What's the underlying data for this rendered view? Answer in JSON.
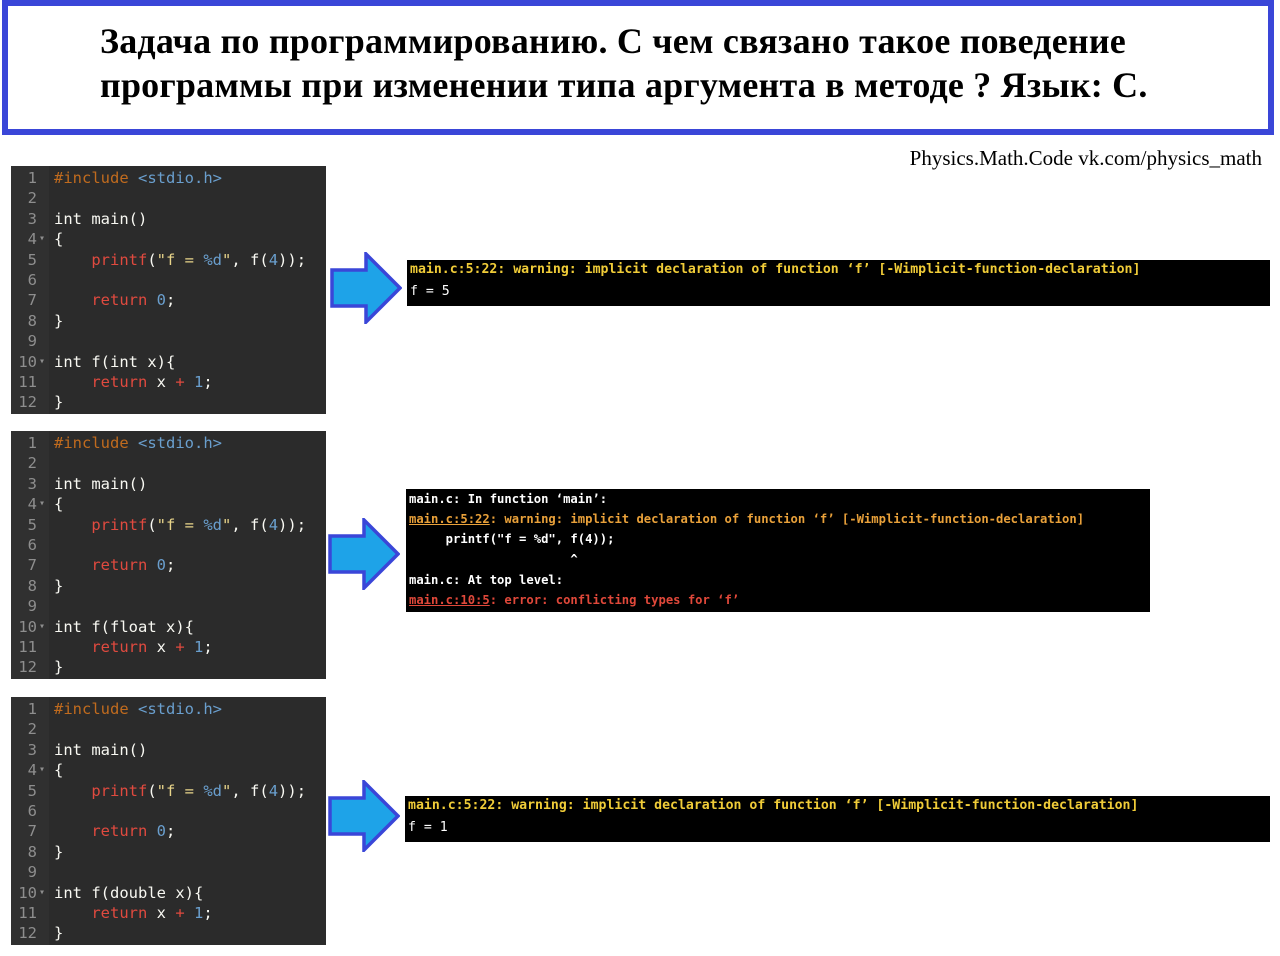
{
  "title": {
    "line1": "Задача по программированию. С чем связано такое поведение",
    "line2": "программы при изменении типа аргумента в методе ? Язык: C."
  },
  "credit": "Physics.Math.Code vk.com/physics_math",
  "colors": {
    "frame": "#3a46d8",
    "arrow": "#1ea3e8",
    "arrow_border": "#3a46d8",
    "warning": "#f0cc38",
    "error": "#e0483a"
  },
  "arrow_icon": "right-arrow-icon",
  "panels": [
    {
      "code": {
        "lines": [
          {
            "n": "1",
            "fold": ""
          },
          {
            "n": "2",
            "fold": ""
          },
          {
            "n": "3",
            "fold": ""
          },
          {
            "n": "4",
            "fold": "▾"
          },
          {
            "n": "5",
            "fold": ""
          },
          {
            "n": "6",
            "fold": ""
          },
          {
            "n": "7",
            "fold": ""
          },
          {
            "n": "8",
            "fold": ""
          },
          {
            "n": "9",
            "fold": ""
          },
          {
            "n": "10",
            "fold": "▾"
          },
          {
            "n": "11",
            "fold": ""
          },
          {
            "n": "12",
            "fold": ""
          }
        ],
        "include": "#include",
        "header": "<stdio.h>",
        "main_sig": "int main()",
        "open_brace": "{",
        "printf": "printf",
        "printf_open": "(",
        "str_a": "\"f = ",
        "str_fmt": "%d",
        "str_b": "\"",
        "printf_mid": ", f(",
        "arg": "4",
        "printf_end": "));",
        "ret_kw": "return",
        "ret_val": "0",
        "semi": ";",
        "close_brace": "}",
        "f_sig": "int f(int x){",
        "ret_x": "x",
        "plus": "+",
        "one": "1"
      },
      "output": {
        "lines": [
          "main.c:5:22: warning: implicit declaration of function ‘f’ [-Wimplicit-function-declaration]",
          "f = 5"
        ]
      }
    },
    {
      "code": {
        "lines": [
          {
            "n": "1",
            "fold": ""
          },
          {
            "n": "2",
            "fold": ""
          },
          {
            "n": "3",
            "fold": ""
          },
          {
            "n": "4",
            "fold": "▾"
          },
          {
            "n": "5",
            "fold": ""
          },
          {
            "n": "6",
            "fold": ""
          },
          {
            "n": "7",
            "fold": ""
          },
          {
            "n": "8",
            "fold": ""
          },
          {
            "n": "9",
            "fold": ""
          },
          {
            "n": "10",
            "fold": "▾"
          },
          {
            "n": "11",
            "fold": ""
          },
          {
            "n": "12",
            "fold": ""
          }
        ],
        "f_sig": "int f(float x){"
      },
      "output": {
        "line1": "main.c: In function ‘main’:",
        "line2_loc": "main.c:5:22",
        "line2_rest": ": warning: implicit declaration of function ‘f’ [-Wimplicit-function-declaration]",
        "line3": "     printf(\"f = %d\", f(4));",
        "line4": "                      ^",
        "line5": "main.c: At top level:",
        "line6_loc": "main.c:10:5",
        "line6_rest": ": error: conflicting types for ‘f’"
      }
    },
    {
      "code": {
        "lines": [
          {
            "n": "1",
            "fold": ""
          },
          {
            "n": "2",
            "fold": ""
          },
          {
            "n": "3",
            "fold": ""
          },
          {
            "n": "4",
            "fold": "▾"
          },
          {
            "n": "5",
            "fold": ""
          },
          {
            "n": "6",
            "fold": ""
          },
          {
            "n": "7",
            "fold": ""
          },
          {
            "n": "8",
            "fold": ""
          },
          {
            "n": "9",
            "fold": ""
          },
          {
            "n": "10",
            "fold": "▾"
          },
          {
            "n": "11",
            "fold": ""
          },
          {
            "n": "12",
            "fold": ""
          }
        ],
        "f_sig": "int f(double x){"
      },
      "output": {
        "lines": [
          "main.c:5:22: warning: implicit declaration of function ‘f’ [-Wimplicit-function-declaration]",
          "f = 1"
        ]
      }
    }
  ]
}
